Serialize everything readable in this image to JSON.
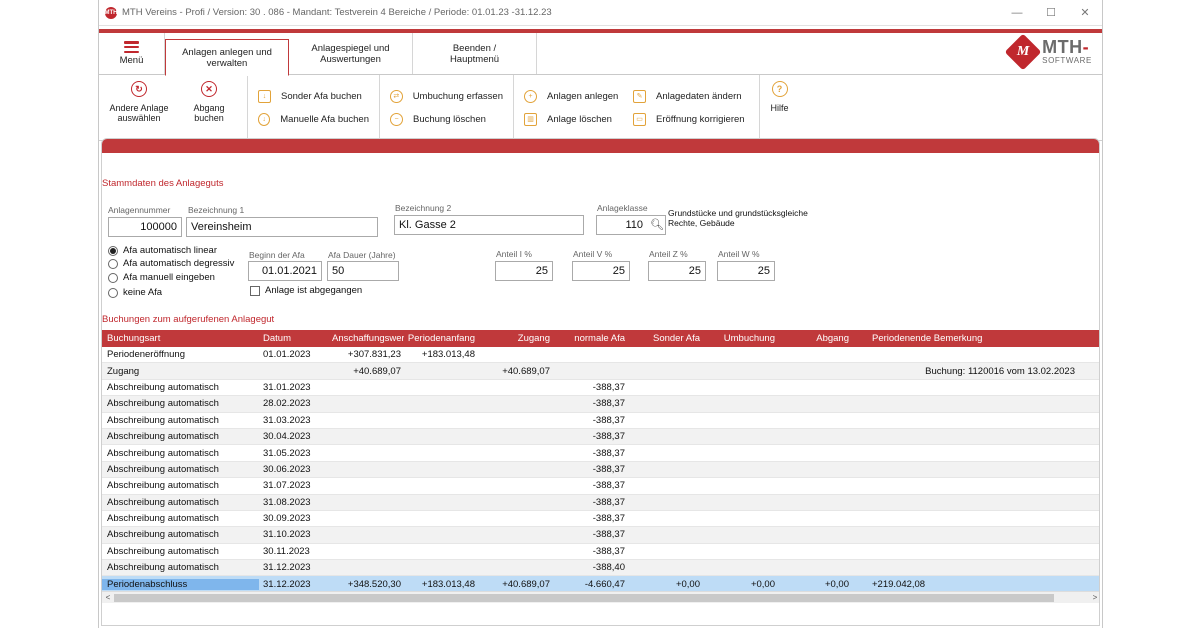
{
  "window": {
    "app_logo_text": "MTH",
    "title": "MTH Vereins - Profi  /  Version: 30 . 086    -    Mandant: Testverein 4 Bereiche  /  Periode: 01.01.23 -31.12.23",
    "minimize": "—",
    "maximize": "☐",
    "close": "✕"
  },
  "tabs": {
    "menu": "Menü",
    "items": [
      {
        "label": "Anlagen anlegen und verwalten",
        "active": true
      },
      {
        "label": "Anlagespiegel und Auswertungen",
        "active": false
      },
      {
        "label": "Beenden / Hauptmenü",
        "active": false
      }
    ]
  },
  "brand": {
    "badge": "M",
    "name": "MTH",
    "sub": "SOFTWARE"
  },
  "ribbon": {
    "other_asset": "Andere Anlage auswählen",
    "disposal": "Abgang buchen",
    "special_dep": "Sonder Afa buchen",
    "manual_dep": "Manuelle Afa buchen",
    "transfer": "Umbuchung erfassen",
    "delete_booking": "Buchung löschen",
    "create_asset": "Anlagen anlegen",
    "delete_asset": "Anlage löschen",
    "change_asset": "Anlagedaten ändern",
    "correct_opening": "Eröffnung korrigieren",
    "help": "Hilfe"
  },
  "master": {
    "section_title": "Stammdaten des Anlageguts",
    "number_label": "Anlagennummer",
    "number": "100000",
    "name1_label": "Bezeichnung 1",
    "name1": "Vereinsheim",
    "name2_label": "Bezeichnung 2",
    "name2": "Kl. Gasse 2",
    "class_label": "Anlageklasse",
    "class": "110",
    "class_desc": "Grundstücke und grundstücksgleiche Rechte, Gebäude",
    "afa_options": [
      "Afa automatisch linear",
      "Afa automatisch degressiv",
      "Afa manuell eingeben",
      "keine Afa"
    ],
    "afa_selected": 0,
    "start_label": "Beginn der Afa",
    "start": "01.01.2021",
    "duration_label": "Afa Dauer (Jahre)",
    "duration": "50",
    "disposed_label": "Anlage ist abgegangen",
    "share_i_label": "Anteil I %",
    "share_i": "25",
    "share_v_label": "Anteil V %",
    "share_v": "25",
    "share_z_label": "Anteil Z %",
    "share_z": "25",
    "share_w_label": "Anteil W %",
    "share_w": "25"
  },
  "bookings": {
    "section_title": "Buchungen zum aufgerufenen Anlagegut",
    "headers": [
      "Buchungsart",
      "Datum",
      "Anschaffungswert",
      "Periodenanfang",
      "Zugang",
      "normale Afa",
      "Sonder Afa",
      "Umbuchung",
      "Abgang",
      "Periodenende Bemerkung"
    ],
    "rows": [
      [
        "Periodeneröffnung",
        "01.01.2023",
        "+307.831,23",
        "+183.013,48",
        "",
        "",
        "",
        "",
        "",
        ""
      ],
      [
        "Zugang",
        "",
        "+40.689,07",
        "",
        "+40.689,07",
        "",
        "",
        "",
        "",
        "Buchung: 1120016 vom 13.02.2023"
      ],
      [
        "Abschreibung automatisch",
        "31.01.2023",
        "",
        "",
        "",
        "-388,37",
        "",
        "",
        "",
        ""
      ],
      [
        "Abschreibung automatisch",
        "28.02.2023",
        "",
        "",
        "",
        "-388,37",
        "",
        "",
        "",
        ""
      ],
      [
        "Abschreibung automatisch",
        "31.03.2023",
        "",
        "",
        "",
        "-388,37",
        "",
        "",
        "",
        ""
      ],
      [
        "Abschreibung automatisch",
        "30.04.2023",
        "",
        "",
        "",
        "-388,37",
        "",
        "",
        "",
        ""
      ],
      [
        "Abschreibung automatisch",
        "31.05.2023",
        "",
        "",
        "",
        "-388,37",
        "",
        "",
        "",
        ""
      ],
      [
        "Abschreibung automatisch",
        "30.06.2023",
        "",
        "",
        "",
        "-388,37",
        "",
        "",
        "",
        ""
      ],
      [
        "Abschreibung automatisch",
        "31.07.2023",
        "",
        "",
        "",
        "-388,37",
        "",
        "",
        "",
        ""
      ],
      [
        "Abschreibung automatisch",
        "31.08.2023",
        "",
        "",
        "",
        "-388,37",
        "",
        "",
        "",
        ""
      ],
      [
        "Abschreibung automatisch",
        "30.09.2023",
        "",
        "",
        "",
        "-388,37",
        "",
        "",
        "",
        ""
      ],
      [
        "Abschreibung automatisch",
        "31.10.2023",
        "",
        "",
        "",
        "-388,37",
        "",
        "",
        "",
        ""
      ],
      [
        "Abschreibung automatisch",
        "30.11.2023",
        "",
        "",
        "",
        "-388,37",
        "",
        "",
        "",
        ""
      ],
      [
        "Abschreibung automatisch",
        "31.12.2023",
        "",
        "",
        "",
        "-388,40",
        "",
        "",
        "",
        ""
      ]
    ],
    "total": [
      "Periodenabschluss",
      "31.12.2023",
      "+348.520,30",
      "+183.013,48",
      "+40.689,07",
      "-4.660,47",
      "+0,00",
      "+0,00",
      "+0,00",
      "+219.042,08"
    ],
    "scroll_left": "<",
    "scroll_right": ">"
  }
}
